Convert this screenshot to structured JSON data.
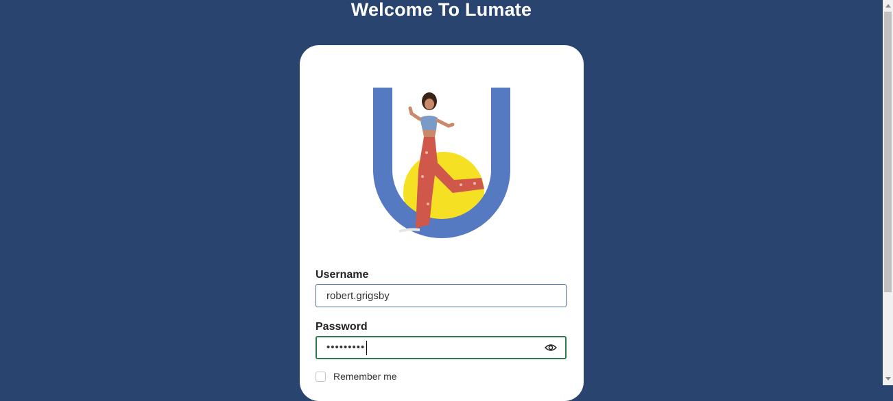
{
  "page": {
    "title": "Welcome To Lumate"
  },
  "login_form": {
    "username_label": "Username",
    "username_value": "robert.grigsby",
    "password_label": "Password",
    "password_masked": "•••••••••",
    "remember_label": "Remember me",
    "remember_checked": false
  },
  "icons": {
    "logo": "lumate-logo",
    "password_toggle": "eye-icon"
  },
  "colors": {
    "background": "#2a4470",
    "card": "#ffffff",
    "logo_blue": "#557ac1",
    "logo_yellow": "#f5e024",
    "focus_border": "#2e7a4a"
  }
}
